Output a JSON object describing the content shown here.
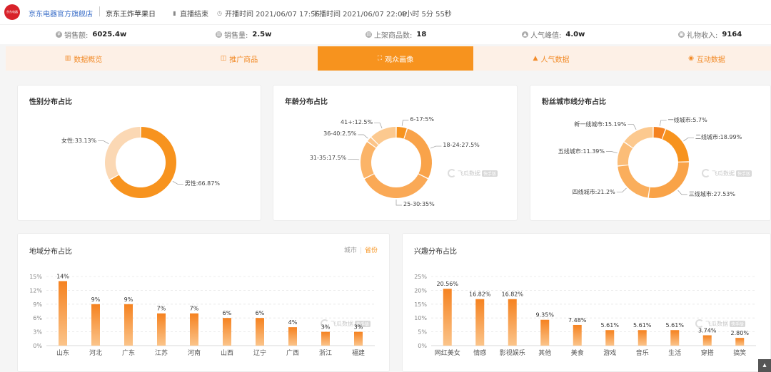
{
  "header": {
    "logo_text": "京东电器",
    "shop_name": "京东电器官方旗舰店",
    "room_name": "京东王炸苹果日",
    "status": "直播结束",
    "start_label": "开播时间 2021/06/07 17:56",
    "end_label": "下播时间 2021/06/07 22:03",
    "duration": "4小时 5分 55秒"
  },
  "stats": [
    {
      "label": "销售额:",
      "value": "6025.4w",
      "icon": "money-icon"
    },
    {
      "label": "销售量:",
      "value": "2.5w",
      "icon": "bar-icon"
    },
    {
      "label": "上架商品数:",
      "value": "18",
      "icon": "box-icon"
    },
    {
      "label": "人气峰值:",
      "value": "4.0w",
      "icon": "fire-icon"
    },
    {
      "label": "礼物收入:",
      "value": "9164",
      "icon": "gift-icon"
    }
  ],
  "tabs": [
    {
      "label": "数据概览",
      "icon": "chart-icon"
    },
    {
      "label": "推广商品",
      "icon": "bag-icon"
    },
    {
      "label": "观众画像",
      "icon": "user-icon"
    },
    {
      "label": "人气数据",
      "icon": "fire-icon"
    },
    {
      "label": "互动数据",
      "icon": "chat-icon"
    }
  ],
  "watermark": {
    "text": "飞瓜数据",
    "tag": "快手版"
  },
  "region_toggle": {
    "city": "城市",
    "province": "省份"
  },
  "chart_data": [
    {
      "type": "pie",
      "title": "性别分布占比",
      "slices": [
        {
          "label": "男性:66.87%",
          "value": 66.87,
          "color": "#f7931e"
        },
        {
          "label": "女性:33.13%",
          "value": 33.13,
          "color": "#fbd8b4"
        }
      ]
    },
    {
      "type": "pie",
      "title": "年龄分布占比",
      "slices": [
        {
          "label": "6-17:5%",
          "value": 5,
          "color": "#f7931e"
        },
        {
          "label": "18-24:27.5%",
          "value": 27.5,
          "color": "#f9a34a"
        },
        {
          "label": "25-30:35%",
          "value": 35,
          "color": "#faa956"
        },
        {
          "label": "31-35:17.5%",
          "value": 17.5,
          "color": "#fbb468"
        },
        {
          "label": "36-40:2.5%",
          "value": 2.5,
          "color": "#fcc488"
        },
        {
          "label": "41+:12.5%",
          "value": 12.5,
          "color": "#fcc98f"
        }
      ]
    },
    {
      "type": "pie",
      "title": "粉丝城市线分布占比",
      "slices": [
        {
          "label": "一线城市:5.7%",
          "value": 5.7,
          "color": "#f58220"
        },
        {
          "label": "二线城市:18.99%",
          "value": 18.99,
          "color": "#f7931e"
        },
        {
          "label": "三线城市:27.53%",
          "value": 27.53,
          "color": "#f9a348"
        },
        {
          "label": "四线城市:21.2%",
          "value": 21.2,
          "color": "#faae5c"
        },
        {
          "label": "五线城市:11.39%",
          "value": 11.39,
          "color": "#fbbd78"
        },
        {
          "label": "新一线城市:15.19%",
          "value": 15.19,
          "color": "#fcc98f"
        }
      ]
    },
    {
      "type": "bar",
      "title": "地域分布占比",
      "categories": [
        "山东",
        "河北",
        "广东",
        "江苏",
        "河南",
        "山西",
        "辽宁",
        "广西",
        "浙江",
        "福建"
      ],
      "values": [
        14,
        9,
        9,
        7,
        7,
        6,
        6,
        4,
        3,
        3
      ],
      "value_labels": [
        "14%",
        "9%",
        "9%",
        "7%",
        "7%",
        "6%",
        "6%",
        "4%",
        "3%",
        "3%"
      ],
      "yticks": [
        "0%",
        "3%",
        "6%",
        "9%",
        "12%",
        "15%"
      ],
      "ylim": [
        0,
        15
      ],
      "grid": true
    },
    {
      "type": "bar",
      "title": "兴趣分布占比",
      "categories": [
        "网红美女",
        "情感",
        "影视娱乐",
        "其他",
        "美食",
        "游戏",
        "音乐",
        "生活",
        "穿搭",
        "搞笑"
      ],
      "values": [
        20.56,
        16.82,
        16.82,
        9.35,
        7.48,
        5.61,
        5.61,
        5.61,
        3.74,
        2.8
      ],
      "value_labels": [
        "20.56%",
        "16.82%",
        "16.82%",
        "9.35%",
        "7.48%",
        "5.61%",
        "5.61%",
        "5.61%",
        "3.74%",
        "2.80%"
      ],
      "yticks": [
        "0%",
        "5%",
        "10%",
        "15%",
        "20%",
        "25%"
      ],
      "ylim": [
        0,
        25
      ],
      "grid": true
    }
  ],
  "colors": {
    "accent": "#f7931e",
    "tab_bg": "#fdf0e6",
    "link": "#3a6ec8"
  }
}
